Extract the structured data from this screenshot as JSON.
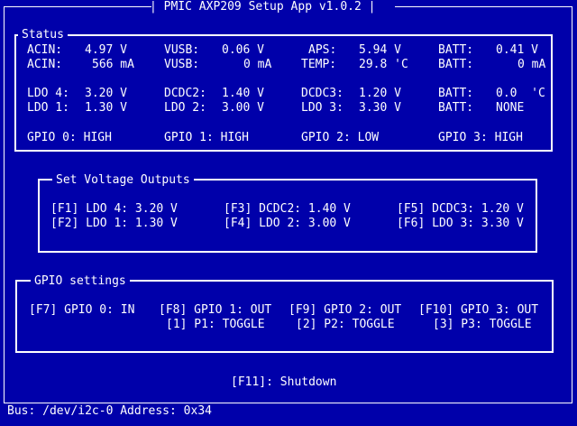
{
  "window": {
    "title": "PMIC AXP209 Setup App v1.0.2"
  },
  "status": {
    "title": "Status",
    "row1": [
      "ACIN:",
      "4.97 V",
      "VUSB:",
      "0.06 V",
      "APS:",
      "5.94 V",
      "BATT:",
      "0.41 V"
    ],
    "row2": [
      "ACIN:",
      "566 mA",
      "VUSB:",
      "0 mA",
      "TEMP:",
      "29.8 'C",
      "BATT:",
      "0 mA"
    ],
    "row3": [
      "LDO 4:",
      "3.20 V",
      "DCDC2:",
      "1.40 V",
      "DCDC3:",
      "1.20 V",
      "BATT:",
      "0.0  'C"
    ],
    "row4": [
      "LDO 1:",
      "1.30 V",
      "LDO 2:",
      "3.00 V",
      "LDO 3:",
      "3.30 V",
      "BATT:",
      "NONE"
    ],
    "gpio": [
      "GPIO 0: HIGH",
      "GPIO 1: HIGH",
      "GPIO 2: LOW",
      "GPIO 3: HIGH"
    ]
  },
  "voltage": {
    "title": "Set Voltage Outputs",
    "items": [
      "[F1] LDO 4: 3.20 V",
      "[F3] DCDC2: 1.40 V",
      "[F5] DCDC3: 1.20 V",
      "[F2] LDO 1: 1.30 V",
      "[F4] LDO 2: 3.00 V",
      "[F6] LDO 3: 3.30 V"
    ]
  },
  "gpio_settings": {
    "title": "GPIO settings",
    "items": [
      "[F7] GPIO 0: IN",
      "[F8] GPIO 1: OUT",
      "[F9] GPIO 2: OUT",
      "[F10] GPIO 3: OUT"
    ],
    "toggles": [
      "[1] P1: TOGGLE",
      "[2] P2: TOGGLE",
      "[3] P3: TOGGLE"
    ]
  },
  "shutdown": {
    "label": "[F11]: Shutdown"
  },
  "footer": {
    "bus": "Bus: /dev/i2c-0 Address: 0x34"
  },
  "colors": {
    "background": "#0000aa",
    "foreground": "#ffffff"
  }
}
